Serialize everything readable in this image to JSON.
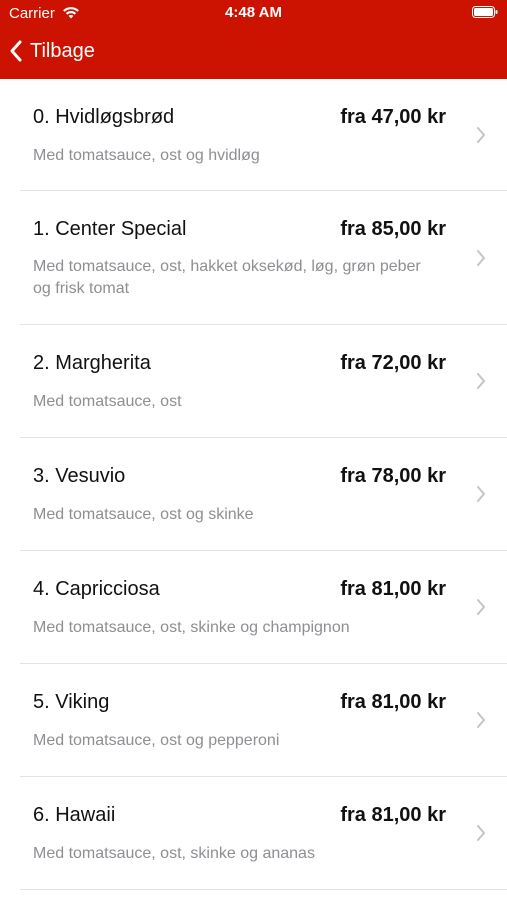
{
  "status_bar": {
    "carrier": "Carrier",
    "time": "4:48 AM"
  },
  "nav": {
    "back_label": "Tilbage",
    "bar_color": "#cc1200"
  },
  "menu_items": [
    {
      "name": "0. Hvidløgsbrød",
      "price": "fra 47,00 kr",
      "description": "Med tomatsauce, ost og hvidløg"
    },
    {
      "name": "1. Center Special",
      "price": "fra 85,00 kr",
      "description": "Med tomatsauce, ost, hakket oksekød, løg, grøn peber og frisk tomat"
    },
    {
      "name": "2. Margherita",
      "price": "fra 72,00 kr",
      "description": "Med tomatsauce, ost"
    },
    {
      "name": "3. Vesuvio",
      "price": "fra 78,00 kr",
      "description": "Med tomatsauce, ost og skinke"
    },
    {
      "name": "4. Capricciosa",
      "price": "fra 81,00 kr",
      "description": "Med tomatsauce, ost, skinke og champignon"
    },
    {
      "name": "5. Viking",
      "price": "fra 81,00 kr",
      "description": "Med tomatsauce, ost og pepperoni"
    },
    {
      "name": "6. Hawaii",
      "price": "fra 81,00 kr",
      "description": "Med tomatsauce, ost, skinke og ananas"
    }
  ]
}
